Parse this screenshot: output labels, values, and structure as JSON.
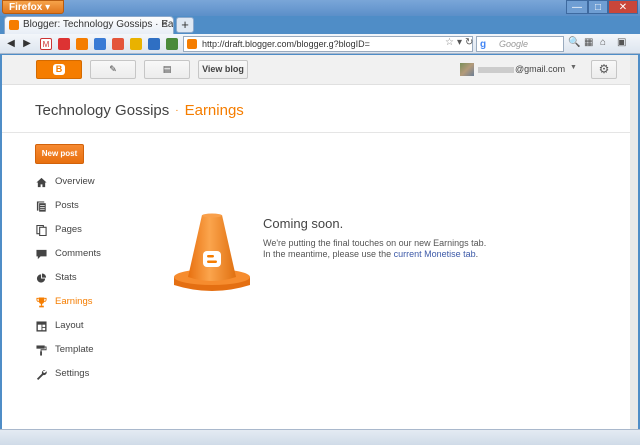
{
  "browser": {
    "menu_button": "Firefox",
    "tab_title": "Blogger: Technology Gossips · Earnings",
    "new_tab": "+",
    "url": "http://draft.blogger.com/blogger.g?blogID=",
    "search_placeholder": "Google"
  },
  "topbar": {
    "view_blog": "View blog",
    "email": "@gmail.com"
  },
  "breadcrumb": {
    "blog_name": "Technology Gossips",
    "separator": "·",
    "current": "Earnings"
  },
  "new_post": "New post",
  "sidebar": {
    "items": [
      {
        "label": "Overview",
        "icon": "home-icon"
      },
      {
        "label": "Posts",
        "icon": "posts-icon"
      },
      {
        "label": "Pages",
        "icon": "pages-icon"
      },
      {
        "label": "Comments",
        "icon": "comment-icon"
      },
      {
        "label": "Stats",
        "icon": "pie-chart-icon"
      },
      {
        "label": "Earnings",
        "icon": "trophy-icon",
        "active": true
      },
      {
        "label": "Layout",
        "icon": "layout-icon"
      },
      {
        "label": "Template",
        "icon": "paint-roller-icon"
      },
      {
        "label": "Settings",
        "icon": "wrench-icon"
      }
    ]
  },
  "main": {
    "title": "Coming soon.",
    "line1": "We're putting the final touches on our new Earnings tab.",
    "line2_prefix": "In the meantime, please use the ",
    "line2_link": "current Monetise tab",
    "line2_suffix": "."
  },
  "colors": {
    "accent": "#f57d00",
    "link": "#3d5aa8"
  }
}
